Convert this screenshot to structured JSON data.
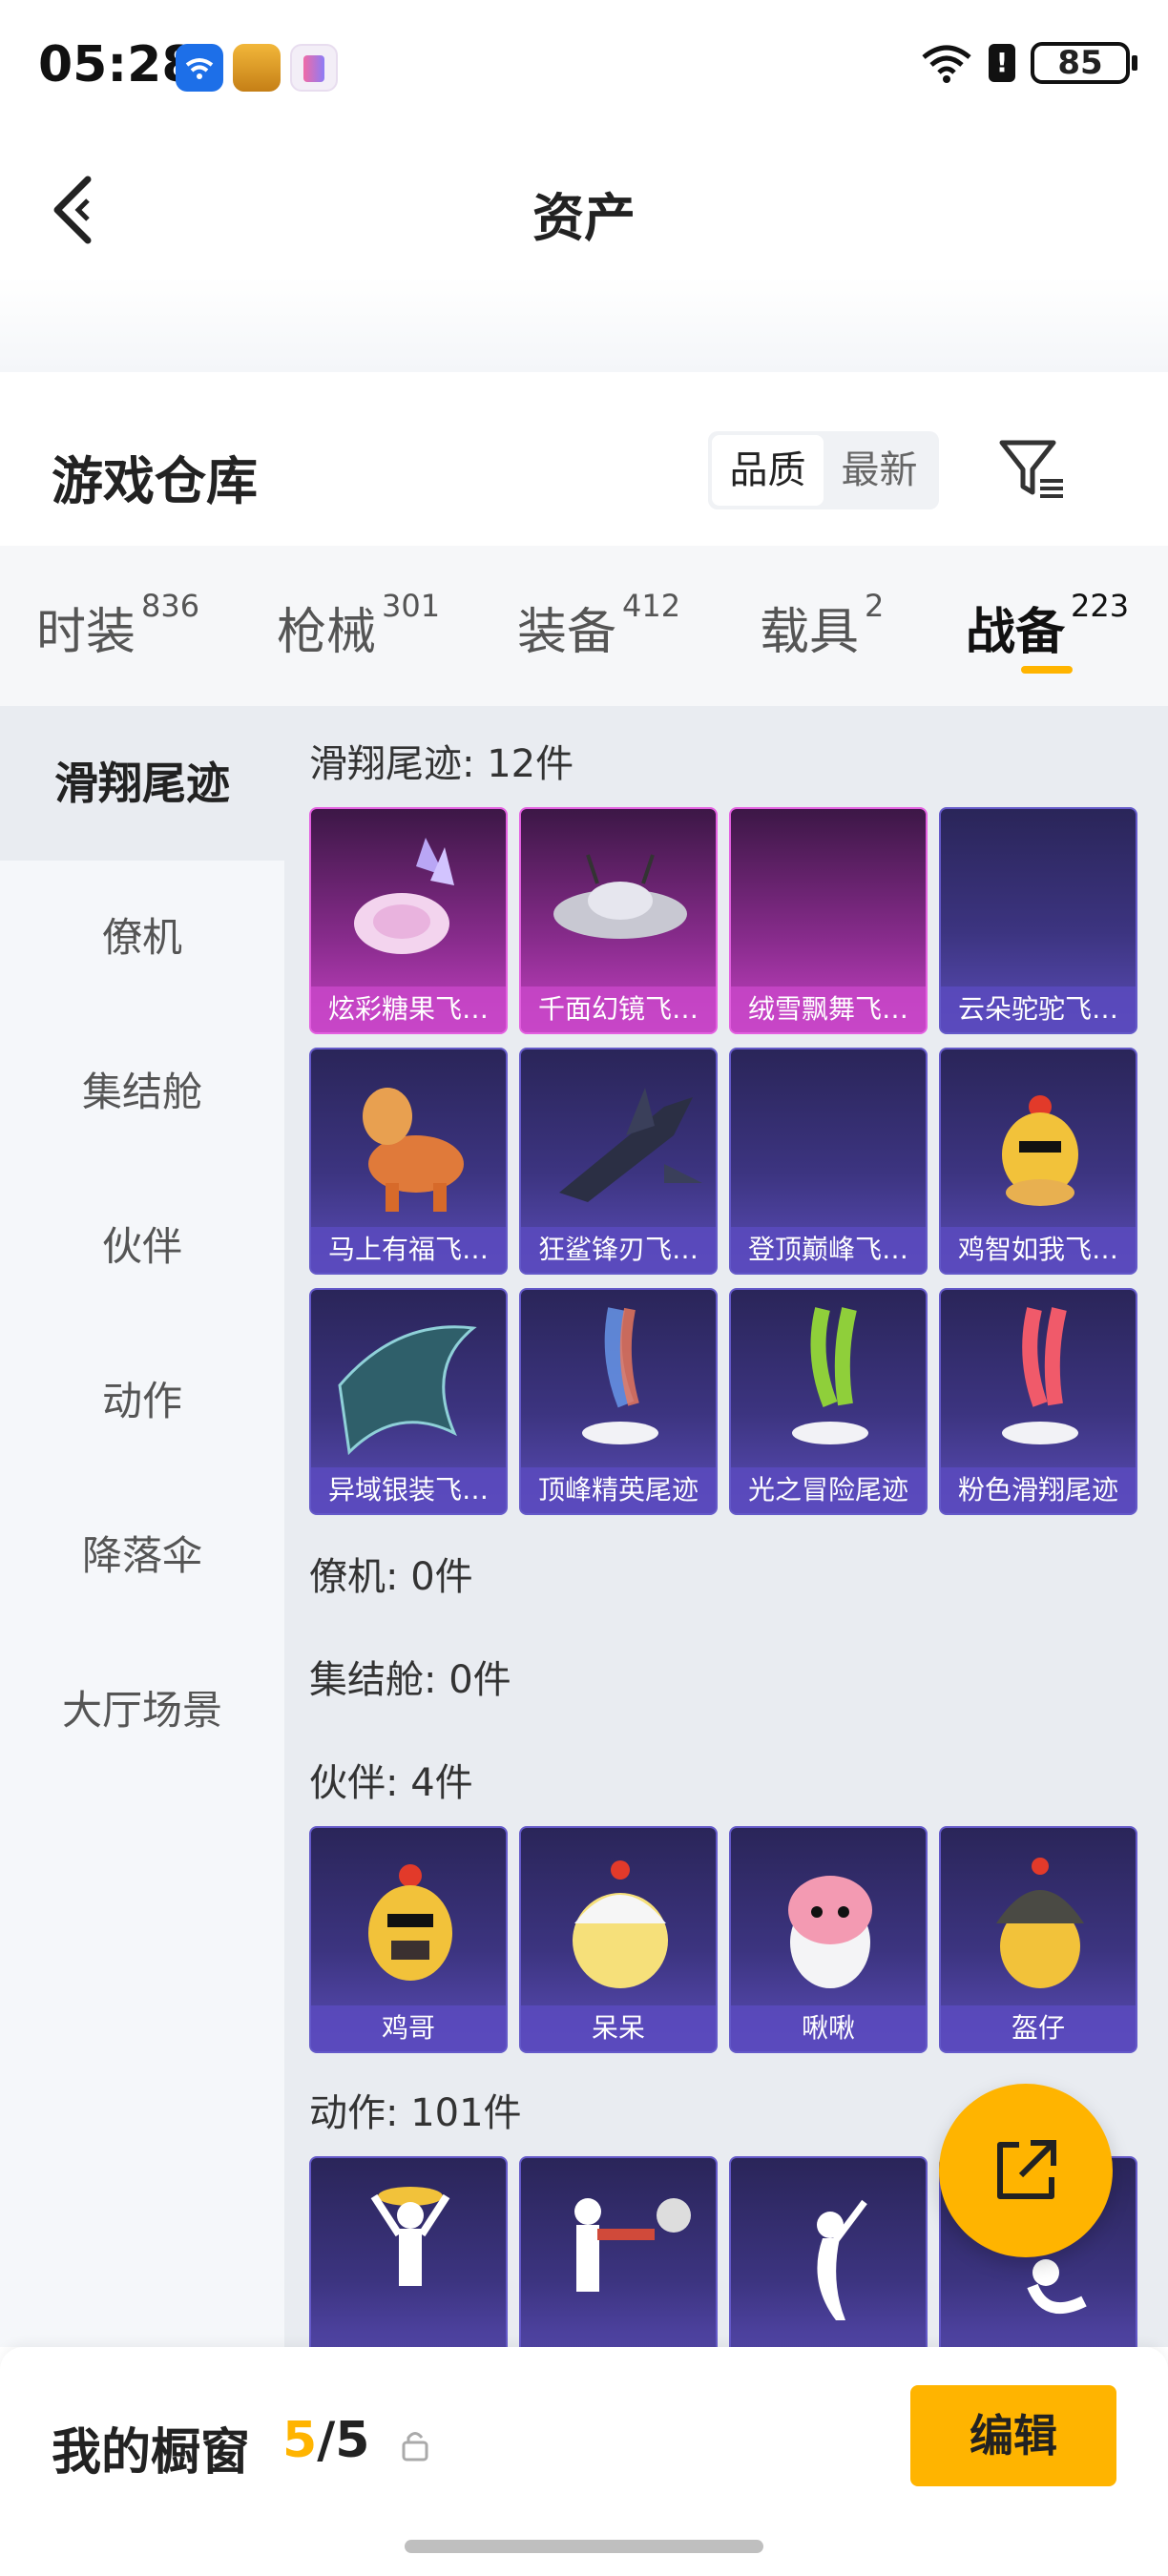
{
  "status_bar": {
    "time": "05:28",
    "battery": "85",
    "alert_glyph": "!",
    "icons": [
      "wifi-app-icon",
      "game-app-icon",
      "i-app-icon",
      "wifi-signal-icon",
      "alert-icon",
      "battery-icon"
    ]
  },
  "header": {
    "title": "资产"
  },
  "warehouse": {
    "title": "游戏仓库",
    "sort_options": [
      "品质",
      "最新"
    ],
    "selected_sort": "品质"
  },
  "tabs": [
    {
      "label": "时装",
      "count": "836"
    },
    {
      "label": "枪械",
      "count": "301"
    },
    {
      "label": "装备",
      "count": "412"
    },
    {
      "label": "载具",
      "count": "2"
    },
    {
      "label": "战备",
      "count": "223",
      "active": true
    }
  ],
  "sidebar": {
    "items": [
      "滑翔尾迹",
      "僚机",
      "集结舱",
      "伙伴",
      "动作",
      "降落伞",
      "大厅场景"
    ],
    "active": "滑翔尾迹"
  },
  "sections": [
    {
      "label": "滑翔尾迹: 12件",
      "items": [
        {
          "name": "炫彩糖果飞…",
          "icon": "candy-glider-icon",
          "rarity": "pink"
        },
        {
          "name": "千面幻镜飞…",
          "icon": "ufo-glider-icon",
          "rarity": "pink"
        },
        {
          "name": "绒雪飘舞飞…",
          "icon": "snow-glider-icon",
          "rarity": "pink"
        },
        {
          "name": "云朵驼驼飞…",
          "icon": "cloud-glider-icon",
          "rarity": "purple"
        },
        {
          "name": "马上有福飞…",
          "icon": "horse-glider-icon",
          "rarity": "purple"
        },
        {
          "name": "狂鲨锋刃飞…",
          "icon": "shark-glider-icon",
          "rarity": "purple"
        },
        {
          "name": "登顶巅峰飞…",
          "icon": "peak-glider-icon",
          "rarity": "purple"
        },
        {
          "name": "鸡智如我飞…",
          "icon": "chicken-glider-icon",
          "rarity": "purple"
        },
        {
          "name": "异域银装飞…",
          "icon": "wing-glider-icon",
          "rarity": "purple"
        },
        {
          "name": "顶峰精英尾迹",
          "icon": "trail-icon",
          "rarity": "purple"
        },
        {
          "name": "光之冒险尾迹",
          "icon": "trail-icon",
          "rarity": "purple"
        },
        {
          "name": "粉色滑翔尾迹",
          "icon": "trail-icon",
          "rarity": "purple"
        }
      ]
    },
    {
      "label": "僚机: 0件",
      "items": []
    },
    {
      "label": "集结舱: 0件",
      "items": []
    },
    {
      "label": "伙伴: 4件",
      "items": [
        {
          "name": "鸡哥",
          "icon": "chicken-partner-icon",
          "rarity": "purple"
        },
        {
          "name": "呆呆",
          "icon": "chick-partner-icon",
          "rarity": "purple"
        },
        {
          "name": "啾啾",
          "icon": "bird-partner-icon",
          "rarity": "purple"
        },
        {
          "name": "盔仔",
          "icon": "helmet-partner-icon",
          "rarity": "purple"
        }
      ]
    },
    {
      "label": "动作: 101件",
      "items": [
        {
          "name": "",
          "icon": "dance-action-icon",
          "rarity": "purple"
        },
        {
          "name": "",
          "icon": "spray-action-icon",
          "rarity": "purple"
        },
        {
          "name": "",
          "icon": "music-action-icon",
          "rarity": "purple"
        },
        {
          "name": "",
          "icon": "kick-action-icon",
          "rarity": "purple"
        }
      ]
    }
  ],
  "showcase": {
    "label": "我的橱窗",
    "current": "5",
    "separator": "/",
    "total": "5",
    "edit_label": "编辑"
  },
  "colors": {
    "accent": "#ffb400",
    "card_purple": "#3c3480",
    "card_pink": "#c542c3"
  }
}
